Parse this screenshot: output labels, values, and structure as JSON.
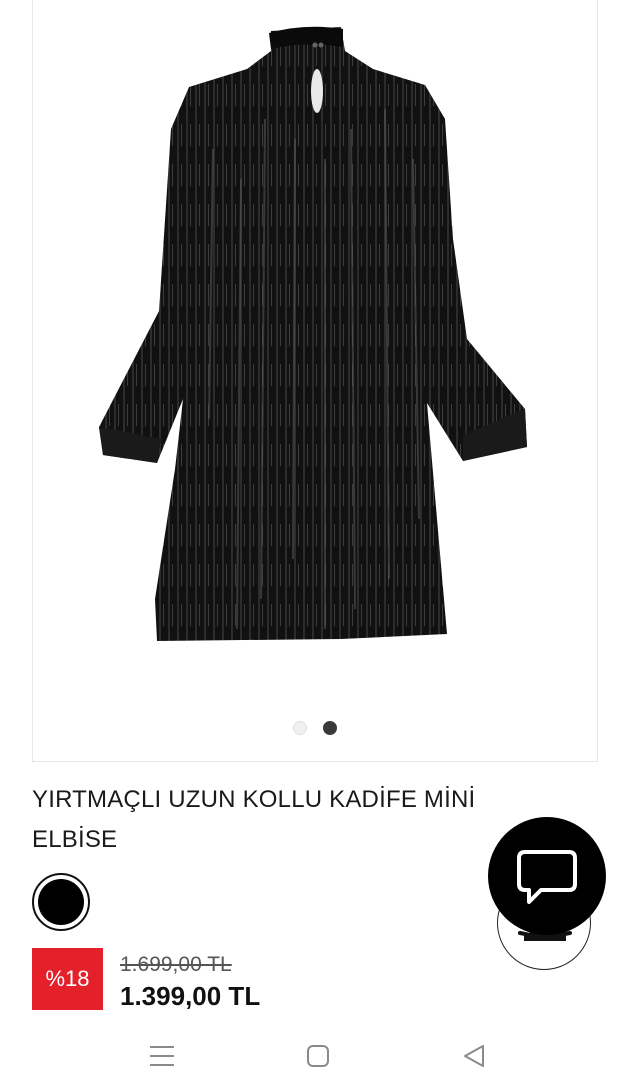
{
  "product": {
    "title": "YIRTMAÇLI UZUN KOLLU KADİFE MİNİ ELBİSE",
    "color_swatch": "#000000",
    "discount_label": "%18",
    "old_price": "1.699,00 TL",
    "new_price": "1.399,00 TL"
  },
  "gallery": {
    "image_icon": "black-dress-image",
    "slide_count": 2,
    "active_slide": 2
  },
  "actions": {
    "chat_icon": "chat-bubble-icon",
    "secondary_icon": "gift-icon"
  },
  "nav": {
    "icons": [
      "menu-icon",
      "home-icon",
      "back-icon"
    ]
  },
  "colors": {
    "discount_red": "#e4202a",
    "chat_fab_bg": "#000000"
  }
}
